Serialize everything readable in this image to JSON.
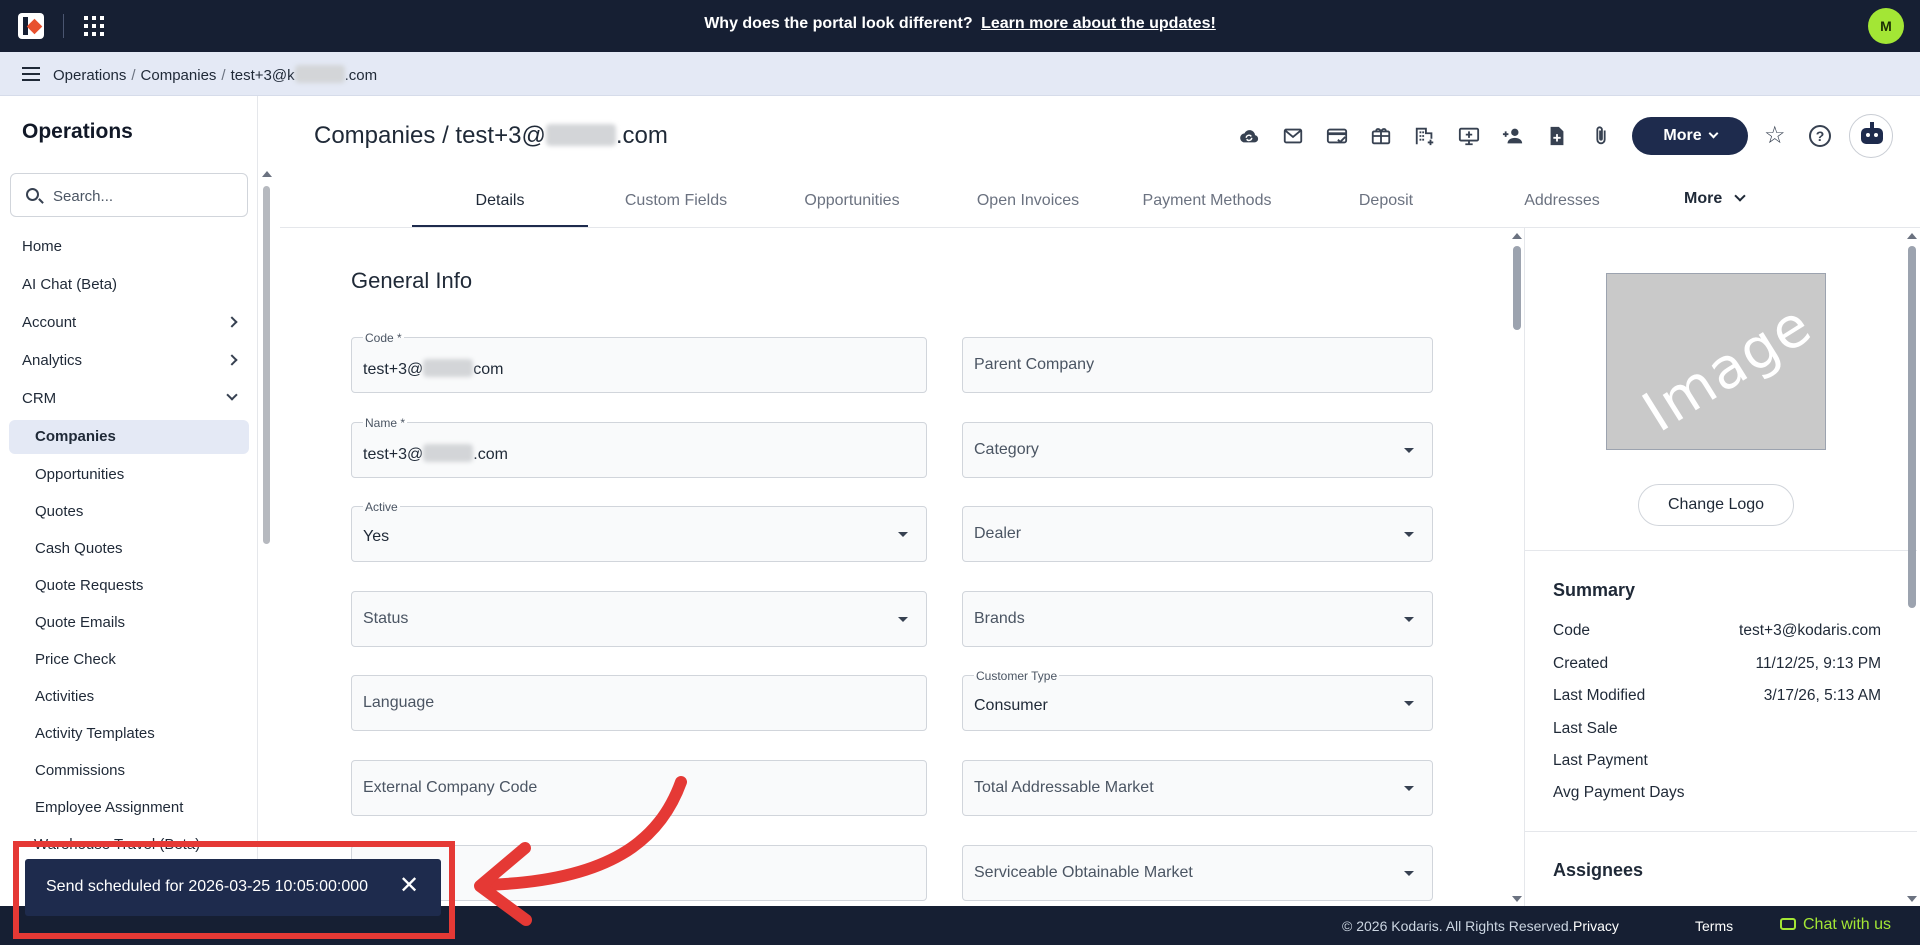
{
  "topbar": {
    "announcement": "Why does the portal look different?",
    "announcement_link": "Learn more about the updates!",
    "avatar_initial": "M"
  },
  "breadcrumb": {
    "items": [
      "Operations",
      "Companies",
      "test+3@k",
      ".com"
    ]
  },
  "sidebar": {
    "title": "Operations",
    "search_placeholder": "Search...",
    "items": [
      {
        "label": "Home"
      },
      {
        "label": "AI Chat (Beta)"
      },
      {
        "label": "Account"
      },
      {
        "label": "Analytics"
      },
      {
        "label": "CRM"
      },
      {
        "label": "Companies"
      },
      {
        "label": "Opportunities"
      },
      {
        "label": "Quotes"
      },
      {
        "label": "Cash Quotes"
      },
      {
        "label": "Quote Requests"
      },
      {
        "label": "Quote Emails"
      },
      {
        "label": "Price Check"
      },
      {
        "label": "Activities"
      },
      {
        "label": "Activity Templates"
      },
      {
        "label": "Commissions"
      },
      {
        "label": "Employee Assignment"
      }
    ],
    "peek_item": "Warehouse Travel (Beta)"
  },
  "header": {
    "title_prefix": "Companies / test+3@",
    "title_suffix": ".com",
    "more_label": "More",
    "toolbar_icons": [
      "cloud-sync-icon",
      "email-icon",
      "credit-card-check-icon",
      "gift-card-icon",
      "building-add-icon",
      "monitor-add-icon",
      "person-add-icon",
      "file-add-icon",
      "paperclip-icon"
    ]
  },
  "tabs": {
    "items": [
      "Details",
      "Custom Fields",
      "Opportunities",
      "Open Invoices",
      "Payment Methods",
      "Deposit",
      "Addresses"
    ],
    "active": "Details",
    "more_label": "More"
  },
  "form": {
    "title": "General Info",
    "code": {
      "label": "Code *",
      "value_prefix": "test+3@",
      "value_suffix": "com"
    },
    "name": {
      "label": "Name *",
      "value_prefix": "test+3@",
      "value_suffix": ".com"
    },
    "active": {
      "label": "Active",
      "value": "Yes"
    },
    "status": {
      "placeholder": "Status"
    },
    "language": {
      "placeholder": "Language"
    },
    "external_code": {
      "placeholder": "External Company Code"
    },
    "parent_company": {
      "placeholder": "Parent Company"
    },
    "category": {
      "placeholder": "Category"
    },
    "dealer": {
      "placeholder": "Dealer"
    },
    "brands": {
      "placeholder": "Brands"
    },
    "customer_type": {
      "label": "Customer Type",
      "value": "Consumer"
    },
    "tam": {
      "placeholder": "Total Addressable Market"
    },
    "som": {
      "placeholder": "Serviceable Obtainable Market"
    }
  },
  "rpanel": {
    "image_placeholder": "Image",
    "change_logo": "Change Logo",
    "summary_title": "Summary",
    "summary": [
      {
        "label": "Code",
        "value": "test+3@kodaris.com"
      },
      {
        "label": "Created",
        "value": "11/12/25, 9:13 PM"
      },
      {
        "label": "Last Modified",
        "value": "3/17/26, 5:13 AM"
      },
      {
        "label": "Last Sale",
        "value": ""
      },
      {
        "label": "Last Payment",
        "value": ""
      },
      {
        "label": "Avg Payment Days",
        "value": ""
      }
    ],
    "assignees_title": "Assignees"
  },
  "footer": {
    "copyright": "© 2026 Kodaris. All Rights Reserved.",
    "privacy": "Privacy",
    "terms": "Terms",
    "chat": "Chat with us"
  },
  "toast": {
    "message": "Send scheduled for 2026-03-25 10:05:00:000",
    "close": "✕"
  },
  "colors": {
    "navy": "#161f33",
    "button_navy": "#1e2b4d",
    "accent_green": "#a3e635",
    "annotation_red": "#e53935"
  }
}
